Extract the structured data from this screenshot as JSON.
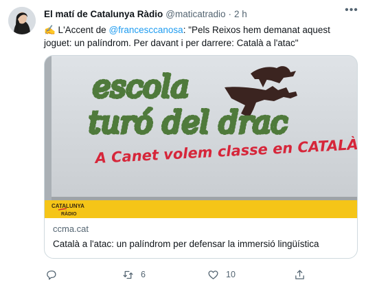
{
  "tweet": {
    "author_name": "El matí de Catalunya Ràdio",
    "handle": "@maticatradio",
    "separator": "·",
    "time": "2 h",
    "text_prefix": "✍️ L'Accent de ",
    "mention": "@francesccanosa",
    "text_suffix": ": \"Pels Reixos hem demanat aquest joguet: un palíndrom. Per davant i per darrere: Català a l'atac\""
  },
  "card": {
    "image_lines": [
      "escola",
      "turó del drac"
    ],
    "graffiti": "A Canet volem classe en CATALÀ!",
    "brand_line1": "CATALUNYA",
    "brand_line2": "RÀDIO",
    "domain": "ccma.cat",
    "title": "Català a l'atac: un palíndrom per defensar la immersió lingüística"
  },
  "actions": {
    "retweets": "6",
    "likes": "10"
  },
  "colors": {
    "link": "#1d9bf0",
    "brand_yellow": "#f5c518",
    "graffiti_red": "#d6263a",
    "rope_green": "#4f7a3b"
  }
}
